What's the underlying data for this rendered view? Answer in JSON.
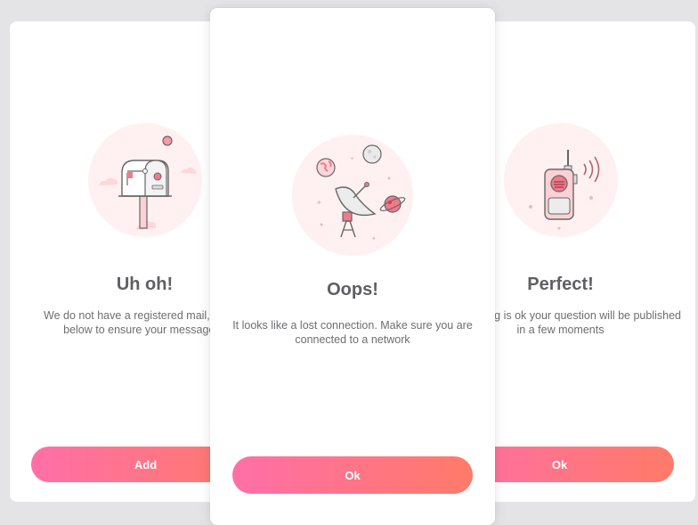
{
  "cards": {
    "left": {
      "title": "Uh oh!",
      "message_line1": "We do not have a registered mail, please",
      "message_line2": "below to ensure your message is",
      "button_label": "Add",
      "illustration_icon": "mailbox-icon"
    },
    "center": {
      "title": "Oops!",
      "message_line1": "It looks like a lost connection. Make sure you are",
      "message_line2": "connected to a network",
      "button_label": "Ok",
      "illustration_icon": "satellite-dish-icon"
    },
    "right": {
      "title": "Perfect!",
      "message_line1": "If everything is ok your question will be published",
      "message_line2": "in a few moments",
      "button_label": "Ok",
      "illustration_icon": "walkie-talkie-icon"
    }
  },
  "colors": {
    "accent_start": "#ff6fa8",
    "accent_end": "#ff7a68",
    "illustration_bg": "#fff1f1",
    "text_title": "#5f5f63",
    "text_body": "#6e6e72",
    "page_bg": "#e4e4e6"
  }
}
